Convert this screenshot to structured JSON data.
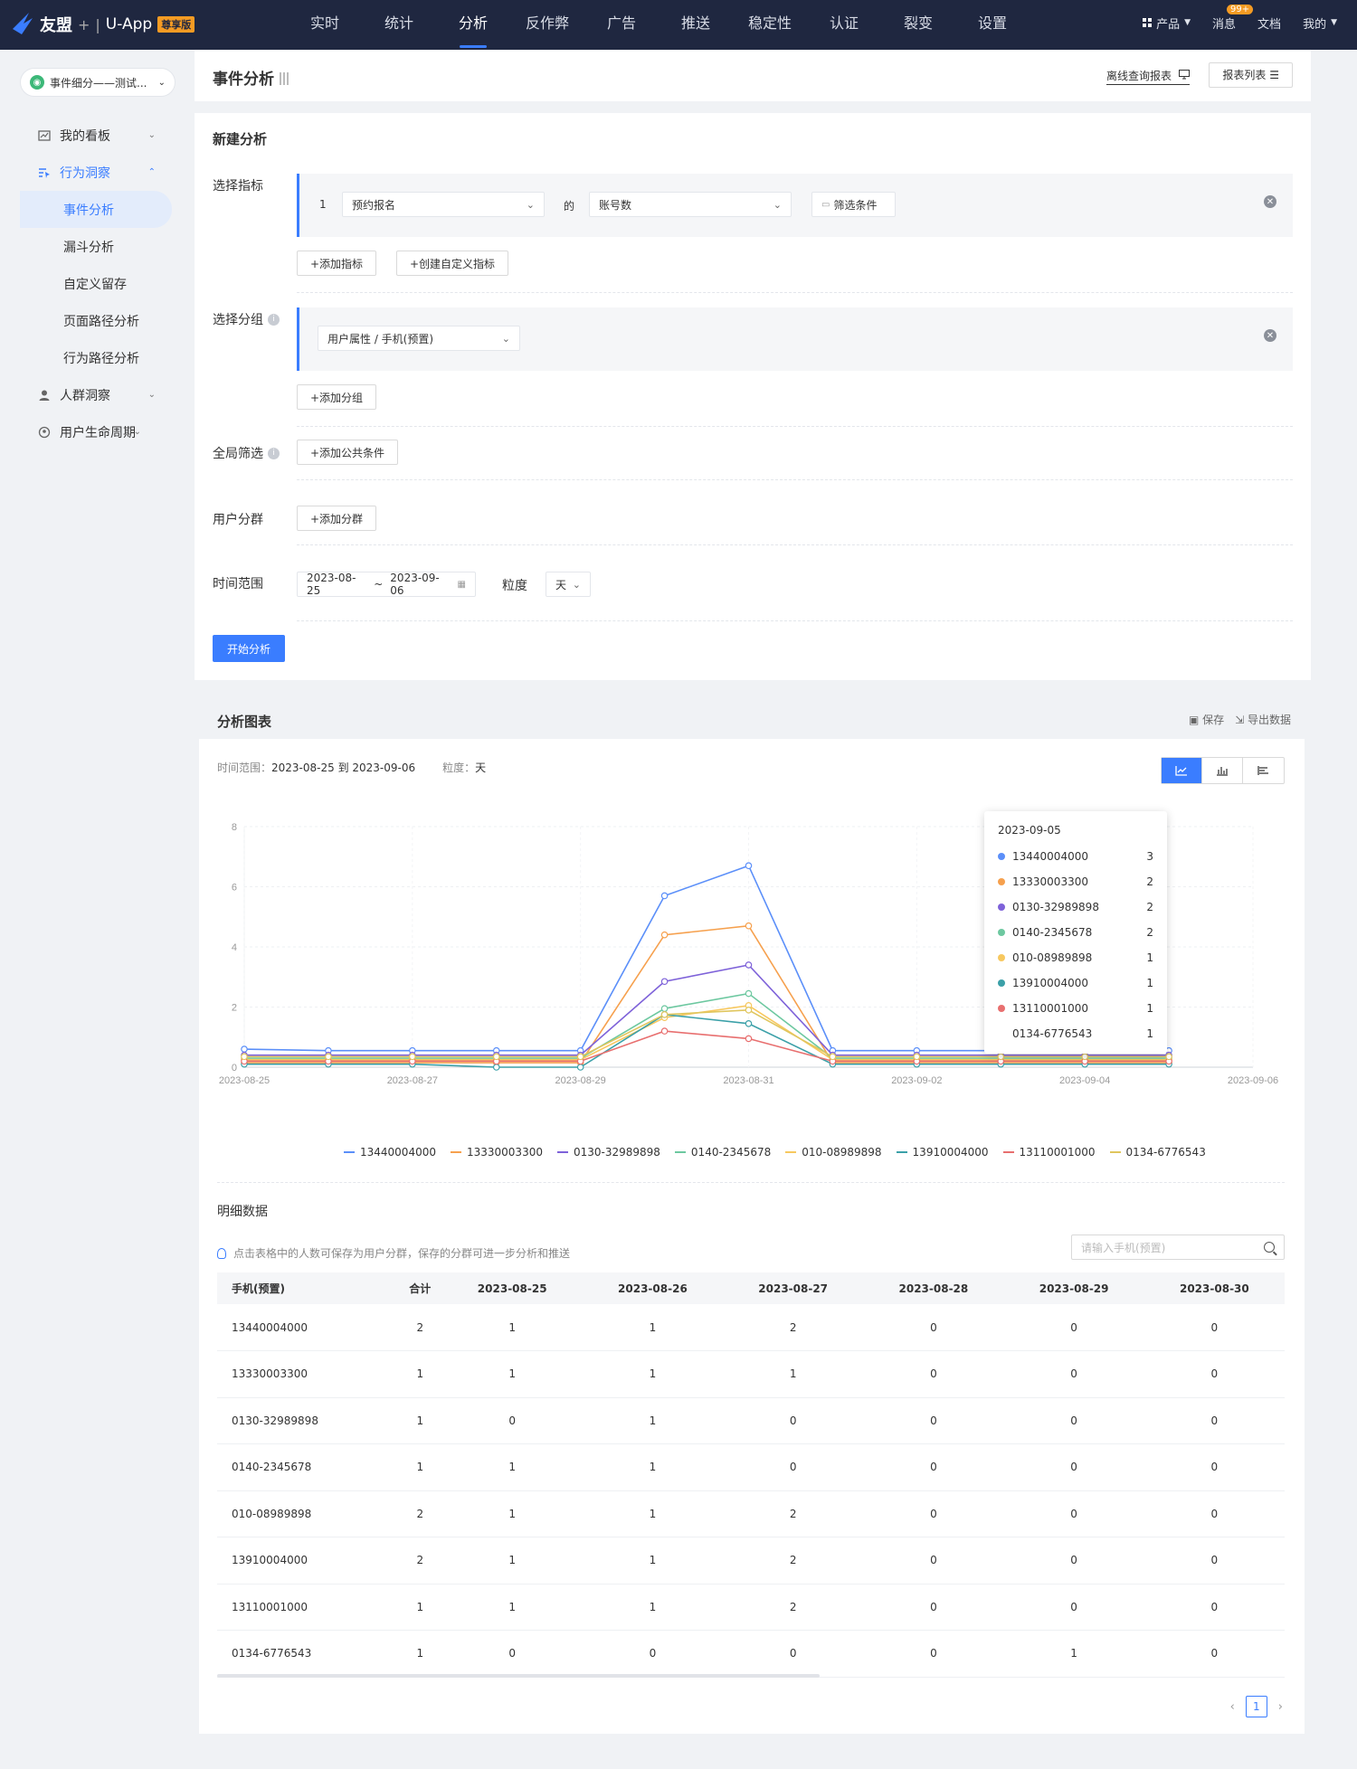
{
  "topnav": {
    "brand": "友盟",
    "plus": "+",
    "app": "U-App",
    "edition": "尊享版",
    "menu": [
      "实时",
      "统计",
      "分析",
      "反作弊",
      "广告",
      "推送",
      "稳定性",
      "认证",
      "裂变",
      "设置"
    ],
    "active_menu": "分析",
    "right": {
      "product": "产品",
      "message": "消息",
      "message_badge": "99+",
      "docs": "文档",
      "mine": "我的"
    }
  },
  "sidebar": {
    "app_selector": "事件细分——测试...",
    "items": [
      {
        "label": "我的看板",
        "icon": "dashboard-icon"
      },
      {
        "label": "行为洞察",
        "icon": "behavior-icon",
        "open": true
      },
      {
        "label": "人群洞察",
        "icon": "people-icon"
      },
      {
        "label": "用户生命周期",
        "icon": "lifecycle-icon"
      }
    ],
    "sub_items": [
      "事件分析",
      "漏斗分析",
      "自定义留存",
      "页面路径分析",
      "行为路径分析"
    ],
    "active_sub": "事件分析"
  },
  "header": {
    "title": "事件分析",
    "offline_report": "离线查询报表",
    "report_list": "报表列表"
  },
  "config": {
    "section_title": "新建分析",
    "metric_label": "选择指标",
    "metric": {
      "index": "1",
      "event": "预约报名",
      "of": "的",
      "measure": "账号数",
      "filter": "筛选条件"
    },
    "add_metric": "+添加指标",
    "create_metric": "+创建自定义指标",
    "group_label": "选择分组",
    "group_value": "用户属性 / 手机(预置)",
    "add_group": "+添加分组",
    "global_filter_label": "全局筛选",
    "add_common": "+添加公共条件",
    "segment_label": "用户分群",
    "add_segment": "+添加分群",
    "time_label": "时间范围",
    "time_start": "2023-08-25",
    "time_sep": "~",
    "time_end": "2023-09-06",
    "granularity_label": "粒度",
    "granularity": "天",
    "start_button": "开始分析"
  },
  "chart_section": {
    "title": "分析图表",
    "save": "保存",
    "export": "导出数据",
    "meta_range_label": "时间范围：",
    "meta_range": "2023-08-25 到 2023-09-06",
    "meta_gran_label": "粒度：",
    "meta_gran": "天"
  },
  "chart_data": {
    "type": "line",
    "x_ticks": [
      "2023-08-25",
      "2023-08-27",
      "2023-08-29",
      "2023-08-31",
      "2023-09-02",
      "2023-09-04",
      "2023-09-06"
    ],
    "y_ticks": [
      0,
      2,
      4,
      6,
      8
    ],
    "ylim": [
      0,
      8
    ],
    "x": [
      "2023-08-25",
      "2023-08-26",
      "2023-08-27",
      "2023-08-28",
      "2023-08-29",
      "2023-08-30",
      "2023-08-31",
      "2023-09-01",
      "2023-09-02",
      "2023-09-03",
      "2023-09-04",
      "2023-09-05"
    ],
    "series": [
      {
        "name": "13440004000",
        "color": "#5b8ff9",
        "values": [
          0.6,
          0.55,
          0.55,
          0.55,
          0.55,
          5.7,
          6.7,
          0.55,
          0.55,
          0.55,
          0.55,
          0.55
        ]
      },
      {
        "name": "13330003300",
        "color": "#f6a04d",
        "values": [
          0.15,
          0.15,
          0.15,
          0.15,
          0.15,
          4.4,
          4.7,
          0.15,
          0.15,
          0.15,
          0.15,
          0.15
        ]
      },
      {
        "name": "0130-32989898",
        "color": "#7e62d9",
        "values": [
          0.4,
          0.4,
          0.4,
          0.4,
          0.4,
          2.85,
          3.4,
          0.4,
          0.4,
          0.4,
          0.4,
          0.4
        ]
      },
      {
        "name": "0140-2345678",
        "color": "#6dc8a0",
        "values": [
          0.3,
          0.3,
          0.3,
          0.3,
          0.3,
          1.95,
          2.45,
          0.3,
          0.3,
          0.3,
          0.3,
          0.3
        ]
      },
      {
        "name": "010-08989898",
        "color": "#f7c85f",
        "values": [
          0.25,
          0.25,
          0.25,
          0.25,
          0.25,
          1.65,
          2.05,
          0.25,
          0.25,
          0.25,
          0.25,
          0.25
        ]
      },
      {
        "name": "13910004000",
        "color": "#3ba0a8",
        "values": [
          0.1,
          0.1,
          0.1,
          0.0,
          0.0,
          1.75,
          1.45,
          0.1,
          0.1,
          0.1,
          0.1,
          0.1
        ]
      },
      {
        "name": "13110001000",
        "color": "#e86f6f",
        "values": [
          0.2,
          0.2,
          0.2,
          0.2,
          0.2,
          1.2,
          0.95,
          0.2,
          0.2,
          0.2,
          0.2,
          0.2
        ]
      },
      {
        "name": "0134-6776543",
        "color": "#e0c65e",
        "values": [
          0.35,
          0.35,
          0.35,
          0.35,
          0.35,
          1.75,
          1.9,
          0.35,
          0.35,
          0.35,
          0.35,
          0.35
        ]
      }
    ],
    "tooltip": {
      "date": "2023-09-05",
      "rows": [
        {
          "name": "13440004000",
          "value": "3",
          "color": "#5b8ff9"
        },
        {
          "name": "13330003300",
          "value": "2",
          "color": "#f6a04d"
        },
        {
          "name": "0130-32989898",
          "value": "2",
          "color": "#7e62d9"
        },
        {
          "name": "0140-2345678",
          "value": "2",
          "color": "#6dc8a0"
        },
        {
          "name": "010-08989898",
          "value": "1",
          "color": "#f7c85f"
        },
        {
          "name": "13910004000",
          "value": "1",
          "color": "#3ba0a8"
        },
        {
          "name": "13110001000",
          "value": "1",
          "color": "#e86f6f"
        },
        {
          "name": "0134-6776543",
          "value": "1",
          "color": "#ffffff"
        }
      ]
    },
    "grid": true,
    "legend_position": "bottom"
  },
  "detail": {
    "title": "明细数据",
    "hint": "点击表格中的人数可保存为用户分群，保存的分群可进一步分析和推送",
    "search_placeholder": "请输入手机(预置)",
    "columns": [
      "手机(预置)",
      "合计",
      "2023-08-25",
      "2023-08-26",
      "2023-08-27",
      "2023-08-28",
      "2023-08-29",
      "2023-08-30"
    ],
    "rows": [
      [
        "13440004000",
        "2",
        "1",
        "1",
        "2",
        "0",
        "0",
        "0"
      ],
      [
        "13330003300",
        "1",
        "1",
        "1",
        "1",
        "0",
        "0",
        "0"
      ],
      [
        "0130-32989898",
        "1",
        "0",
        "1",
        "0",
        "0",
        "0",
        "0"
      ],
      [
        "0140-2345678",
        "1",
        "1",
        "1",
        "0",
        "0",
        "0",
        "0"
      ],
      [
        "010-08989898",
        "2",
        "1",
        "1",
        "2",
        "0",
        "0",
        "0"
      ],
      [
        "13910004000",
        "2",
        "1",
        "1",
        "2",
        "0",
        "0",
        "0"
      ],
      [
        "13110001000",
        "1",
        "1",
        "1",
        "2",
        "0",
        "0",
        "0"
      ],
      [
        "0134-6776543",
        "1",
        "0",
        "0",
        "0",
        "0",
        "1",
        "0"
      ]
    ],
    "page": "1"
  }
}
